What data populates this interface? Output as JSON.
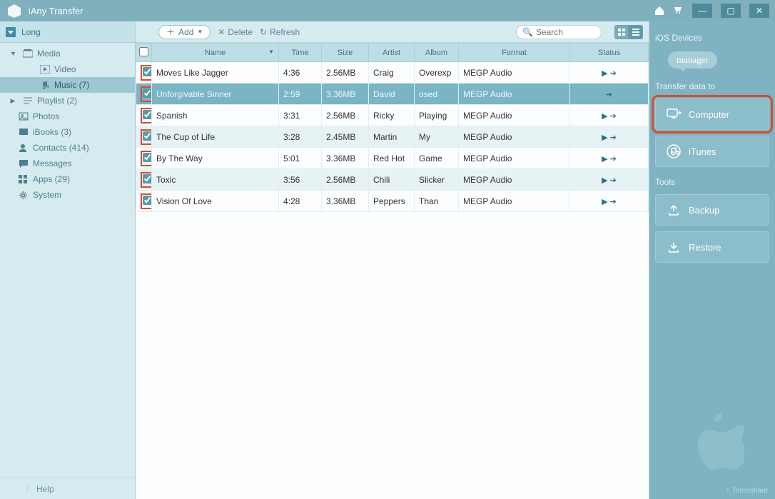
{
  "titlebar": {
    "title": "iAny Transfer"
  },
  "sidebar": {
    "device": "Long",
    "items": [
      {
        "label": "Media",
        "level": 1,
        "caret": "down"
      },
      {
        "label": "Video",
        "level": 2
      },
      {
        "label": "Music (7)",
        "level": 2,
        "active": true
      },
      {
        "label": "Playlist (2)",
        "level": 1,
        "caret": "right"
      },
      {
        "label": "Photos",
        "level": 1
      },
      {
        "label": "iBooks (3)",
        "level": 1
      },
      {
        "label": "Contacts (414)",
        "level": 1
      },
      {
        "label": "Messages",
        "level": 1
      },
      {
        "label": "Apps (29)",
        "level": 1
      },
      {
        "label": "System",
        "level": 1
      }
    ],
    "help": "Help"
  },
  "toolbar": {
    "add": "Add",
    "delete": "Delete",
    "refresh": "Refresh",
    "search_placeholder": "Search"
  },
  "table": {
    "headers": {
      "name": "Name",
      "time": "Time",
      "size": "Size",
      "artist": "Artist",
      "album": "Album",
      "format": "Format",
      "status": "Status"
    },
    "rows": [
      {
        "name": "Moves Like Jagger",
        "time": "4:36",
        "size": "2.56MB",
        "artist": "Craig",
        "album": "Overexp",
        "format": "MEGP Audio",
        "status": "play-arrow"
      },
      {
        "name": "Unforgivable Sinner",
        "time": "2:59",
        "size": "3.36MB",
        "artist": "David",
        "album": "osed",
        "format": "MEGP Audio",
        "status": "arrow",
        "selected": true
      },
      {
        "name": "Spanish",
        "time": "3:31",
        "size": "2.56MB",
        "artist": "Ricky",
        "album": "Playing",
        "format": "MEGP Audio",
        "status": "play-arrow"
      },
      {
        "name": "The Cup of Life",
        "time": "3:28",
        "size": "2.45MB",
        "artist": "Martin",
        "album": "My",
        "format": "MEGP Audio",
        "status": "play-arrow"
      },
      {
        "name": "By The Way",
        "time": "5:01",
        "size": "3.36MB",
        "artist": "Red Hot",
        "album": "Game",
        "format": "MEGP Audio",
        "status": "play-arrow"
      },
      {
        "name": "Toxic",
        "time": "3:56",
        "size": "2.56MB",
        "artist": "Chili",
        "album": "Slicker",
        "format": "MEGP Audio",
        "status": "play-arrow"
      },
      {
        "name": "Vision Of Love",
        "time": "4:28",
        "size": "3.36MB",
        "artist": "Peppers",
        "album": "Than",
        "format": "MEGP Audio",
        "status": "play-arrow"
      }
    ]
  },
  "panel": {
    "section1": "iOS Devices",
    "manager": "manager",
    "section2": "Transfer data to",
    "computer": "Computer",
    "itunes": "iTunes",
    "section3": "Tools",
    "backup": "Backup",
    "restore": "Restore",
    "brand": "Tenorshare"
  }
}
